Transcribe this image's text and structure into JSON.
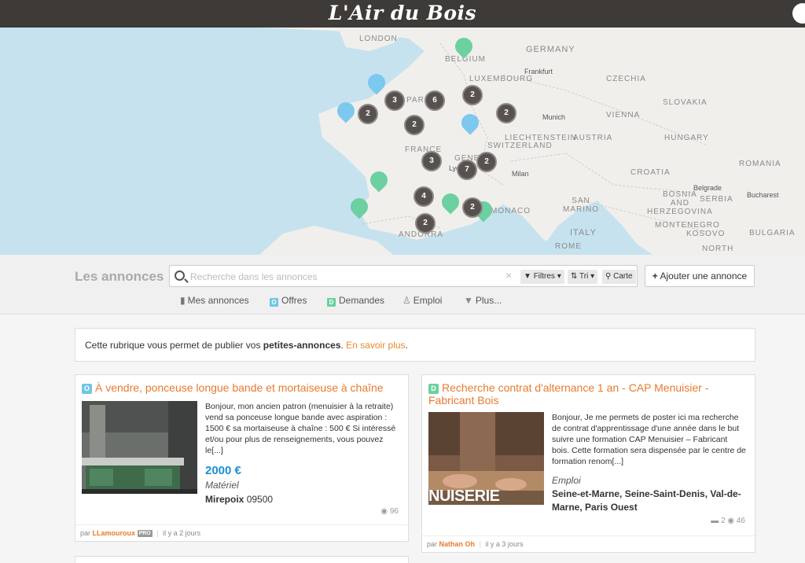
{
  "header": {
    "logo": "L'Air du Bois"
  },
  "map": {
    "labels": {
      "london": "LONDON",
      "belgium": "BELGIUM",
      "germany": "GERMANY",
      "frankfurt": "Frankfurt",
      "luxembourg": "LUXEMBOURG",
      "czechia": "CZECHIA",
      "paris": "PARIS",
      "slovakia": "SLOVAKIA",
      "munich": "Munich",
      "vienna": "VIENNA",
      "france": "FRANCE",
      "liechtenstein": "LIECHTENSTEIN",
      "austria": "AUSTRIA",
      "switzerland": "SWITZERLAND",
      "hungary": "HUNGARY",
      "geneva": "GENEV",
      "lyon": "Lyo",
      "milan": "Milan",
      "croatia": "CROATIA",
      "romania": "ROMANIA",
      "belgrade": "Belgrade",
      "bucharest": "Bucharest",
      "bosnia": "BOSNIA\nAND\nHERZEGOVINA",
      "serbia": "SERBIA",
      "san_marino": "SAN\nMARINO",
      "monaco": "MONACO",
      "andorra": "ANDORRA",
      "italy": "ITALY",
      "montenegro": "MONTENEGRO",
      "kosovo": "KOSOVO",
      "bulgaria": "BULGARIA",
      "rome": "ROME",
      "north": "NORTH"
    },
    "clusters": [
      "3",
      "6",
      "2",
      "2",
      "2",
      "2",
      "3",
      "7",
      "2",
      "4",
      "2",
      "2"
    ]
  },
  "search": {
    "section_title": "Les annonces",
    "placeholder": "Recherche dans les annonces",
    "clear": "×",
    "filters_label": "Filtres",
    "sort_label": "Tri",
    "map_label": "Carte",
    "add_label": "Ajouter une annonce"
  },
  "filters": {
    "mine": "Mes annonces",
    "offers_badge": "O",
    "offers": "Offres",
    "demands_badge": "D",
    "demands": "Demandes",
    "jobs": "Emploi",
    "more": "Plus..."
  },
  "info": {
    "text_before": "Cette rubrique vous permet de publier vos ",
    "strong": "petites-annonces",
    "text_mid": ". ",
    "link": "En savoir plus",
    "text_after": "."
  },
  "listings": [
    {
      "badge": "O",
      "title": "À vendre, ponceuse longue bande et mortaiseuse à chaîne",
      "excerpt": "Bonjour, mon ancien patron (menuisier à la retraite) vend sa ponceuse longue bande avec aspiration : 1500 € sa mortaiseuse à chaîne : 500 € Si intéressé et/ou pour plus de renseignements, vous pouvez le[...]",
      "price": "2000 €",
      "category": "Matériel",
      "city": "Mirepoix",
      "zip": "09500",
      "views": "96",
      "author_prefix": "par",
      "author": "LLamouroux",
      "pro": "PRO",
      "date": "il y a 2 jours"
    },
    {
      "badge": "D",
      "title": "Recherche contrat d'alternance 1 an - CAP Menuisier - Fabricant Bois",
      "excerpt": "Bonjour, Je me permets de poster ici ma recherche de contrat d'apprentissage d'une année dans le but suivre une formation CAP Menuisier – Fabricant bois. Cette formation sera dispensée par le centre de formation renom[...]",
      "photo_caption": "NUISERIE",
      "category": "Emploi",
      "city": "Seine-et-Marne, Seine-Saint-Denis, Val-de-Marne, Paris Ouest",
      "comments": "2",
      "views": "46",
      "author_prefix": "par",
      "author": "Nathan Oh",
      "date": "il y a 3 jours"
    }
  ],
  "colors": {
    "accent": "#e87a2e",
    "price": "#1a8fd6",
    "offer_badge": "#6fc5e6",
    "demand_badge": "#6cd0a0",
    "header": "#3e3a37"
  }
}
